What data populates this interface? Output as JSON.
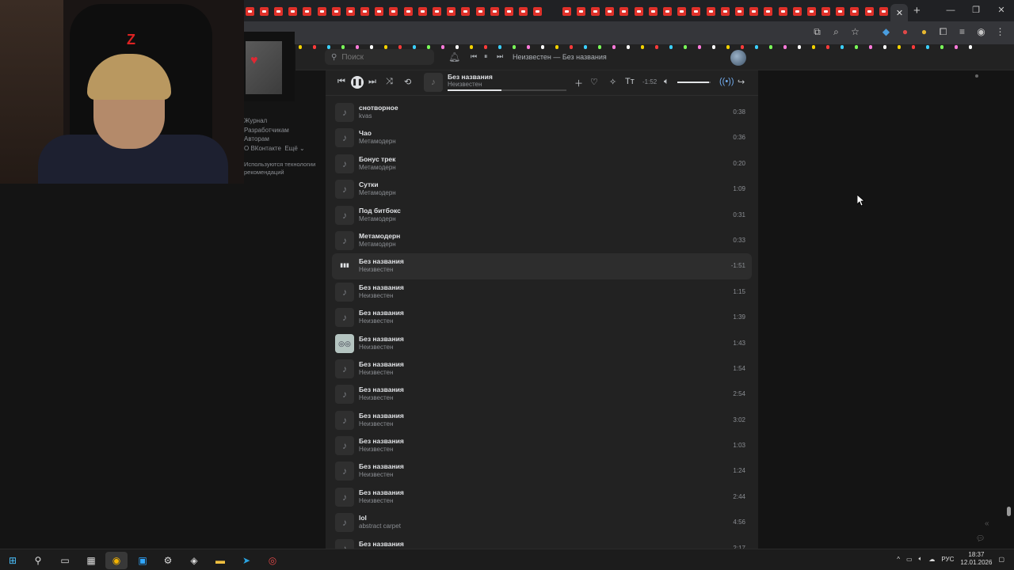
{
  "browser": {
    "tab_count": 45,
    "new_tab_label": "+",
    "window_controls": [
      "—",
      "❐",
      "✕"
    ]
  },
  "vk": {
    "search_placeholder": "Поиск",
    "header_now_playing": "Неизвестен — Без названия",
    "sidebar": {
      "links": [
        "Журнал",
        "Разработчикам",
        "Авторам"
      ],
      "about": "О ВКонтакте",
      "more": "Ещё",
      "note": "Используются технологии рекомендаций"
    }
  },
  "player": {
    "title": "Без названия",
    "artist": "Неизвестен",
    "time_left": "-1:52",
    "progress": 0.45,
    "volume": 0.95
  },
  "tracks": [
    {
      "title": "снотворное",
      "artist": "kvas",
      "duration": "0:38"
    },
    {
      "title": "Чао",
      "artist": "Метамодерн",
      "duration": "0:36"
    },
    {
      "title": "Бонус трек",
      "artist": "Метамодерн",
      "duration": "0:20"
    },
    {
      "title": "Сутки",
      "artist": "Метамодерн",
      "duration": "1:09"
    },
    {
      "title": "Под битбокс",
      "artist": "Метамодерн",
      "duration": "0:31"
    },
    {
      "title": "Метамодерн",
      "artist": "Метамодерн",
      "duration": "0:33"
    },
    {
      "title": "Без названия",
      "artist": "Неизвестен",
      "duration": "-1:51",
      "playing": true
    },
    {
      "title": "Без названия",
      "artist": "Неизвестен",
      "duration": "1:15"
    },
    {
      "title": "Без названия",
      "artist": "Неизвестен",
      "duration": "1:39"
    },
    {
      "title": "Без названия",
      "artist": "Неизвестен",
      "duration": "1:43",
      "has_cover": true
    },
    {
      "title": "Без названия",
      "artist": "Неизвестен",
      "duration": "1:54"
    },
    {
      "title": "Без названия",
      "artist": "Неизвестен",
      "duration": "2:54"
    },
    {
      "title": "Без названия",
      "artist": "Неизвестен",
      "duration": "3:02"
    },
    {
      "title": "Без названия",
      "artist": "Неизвестен",
      "duration": "1:03"
    },
    {
      "title": "Без названия",
      "artist": "Неизвестен",
      "duration": "1:24"
    },
    {
      "title": "Без названия",
      "artist": "Неизвестен",
      "duration": "2:44"
    },
    {
      "title": "lol",
      "artist": "abstract carpet",
      "duration": "4:56"
    },
    {
      "title": "Без названия",
      "artist": "",
      "duration": "2:17"
    }
  ],
  "taskbar": {
    "lang": "РУС",
    "time": "18:37",
    "date": "12.01.2026",
    "tray_arrow": "^"
  }
}
